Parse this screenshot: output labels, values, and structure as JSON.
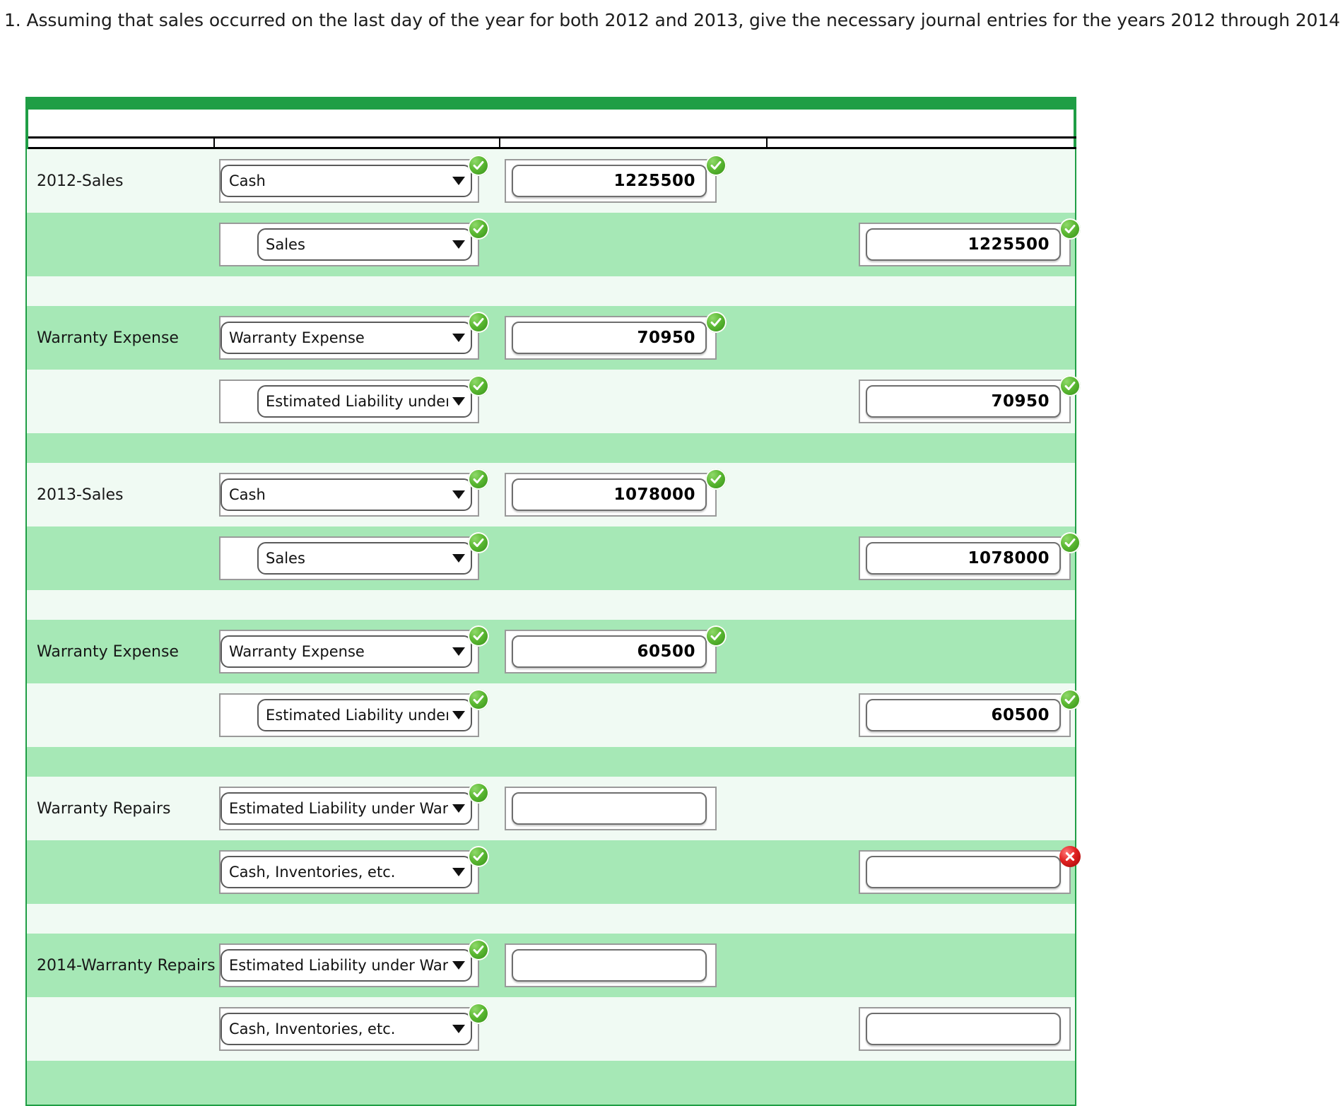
{
  "question": "1. Assuming that sales occurred on the last day of the year for both 2012 and 2013, give the necessary journal entries for the years 2012 through 2014.",
  "colors": {
    "accent_green": "#1f9e45",
    "row_light": "#f0faf3",
    "row_dark": "#a6e8b6",
    "status_ok": "#2f8a13",
    "status_error": "#e02020"
  },
  "icons": {
    "ok": "check-circle-icon",
    "error": "error-circle-icon",
    "caret": "chevron-down-icon"
  },
  "journal": {
    "rows": [
      {
        "kind": "entry",
        "shade": "light",
        "label": "2012-Sales",
        "account": "Cash",
        "indent": false,
        "debit": "1225500",
        "credit": null,
        "account_status": "ok",
        "debit_status": "ok",
        "credit_status": null
      },
      {
        "kind": "entry",
        "shade": "dark",
        "label": "",
        "account": "Sales",
        "indent": true,
        "debit": null,
        "credit": "1225500",
        "account_status": "ok",
        "debit_status": null,
        "credit_status": "ok"
      },
      {
        "kind": "spacer",
        "shade": "light"
      },
      {
        "kind": "entry",
        "shade": "dark",
        "label": "Warranty Expense",
        "account": "Warranty Expense",
        "indent": false,
        "debit": "70950",
        "credit": null,
        "account_status": "ok",
        "debit_status": "ok",
        "credit_status": null
      },
      {
        "kind": "entry",
        "shade": "light",
        "label": "",
        "account": "Estimated Liability under Warr",
        "indent": true,
        "debit": null,
        "credit": "70950",
        "account_status": "ok",
        "debit_status": null,
        "credit_status": "ok"
      },
      {
        "kind": "spacer",
        "shade": "dark"
      },
      {
        "kind": "entry",
        "shade": "light",
        "label": "2013-Sales",
        "account": "Cash",
        "indent": false,
        "debit": "1078000",
        "credit": null,
        "account_status": "ok",
        "debit_status": "ok",
        "credit_status": null
      },
      {
        "kind": "entry",
        "shade": "dark",
        "label": "",
        "account": "Sales",
        "indent": true,
        "debit": null,
        "credit": "1078000",
        "account_status": "ok",
        "debit_status": null,
        "credit_status": "ok"
      },
      {
        "kind": "spacer",
        "shade": "light"
      },
      {
        "kind": "entry",
        "shade": "dark",
        "label": "Warranty Expense",
        "account": "Warranty Expense",
        "indent": false,
        "debit": "60500",
        "credit": null,
        "account_status": "ok",
        "debit_status": "ok",
        "credit_status": null
      },
      {
        "kind": "entry",
        "shade": "light",
        "label": "",
        "account": "Estimated Liability under Warr",
        "indent": true,
        "debit": null,
        "credit": "60500",
        "account_status": "ok",
        "debit_status": null,
        "credit_status": "ok"
      },
      {
        "kind": "spacer",
        "shade": "dark"
      },
      {
        "kind": "entry",
        "shade": "light",
        "label": "Warranty Repairs",
        "account": "Estimated Liability under Warr",
        "indent": false,
        "debit": "",
        "credit": null,
        "account_status": "ok",
        "debit_status": null,
        "credit_status": null
      },
      {
        "kind": "entry",
        "shade": "dark",
        "label": "",
        "account": "Cash, Inventories, etc.",
        "indent": false,
        "debit": null,
        "credit": "",
        "account_status": "ok",
        "debit_status": null,
        "credit_status": "error"
      },
      {
        "kind": "spacer",
        "shade": "light"
      },
      {
        "kind": "entry",
        "shade": "dark",
        "label": "2014-Warranty Repairs",
        "account": "Estimated Liability under Warr",
        "indent": false,
        "debit": "",
        "credit": null,
        "account_status": "ok",
        "debit_status": null,
        "credit_status": null
      },
      {
        "kind": "entry",
        "shade": "light",
        "label": "",
        "account": "Cash, Inventories, etc.",
        "indent": false,
        "debit": null,
        "credit": "",
        "account_status": "ok",
        "debit_status": null,
        "credit_status": null
      },
      {
        "kind": "endpad",
        "shade": "dark"
      }
    ]
  }
}
